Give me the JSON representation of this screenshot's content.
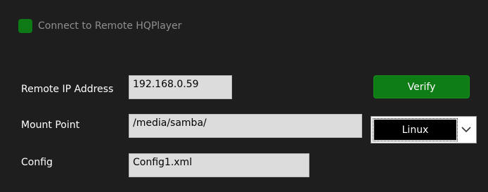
{
  "connect": {
    "label": "Connect to Remote HQPlayer",
    "checked": true
  },
  "form": {
    "remote_ip_label": "Remote IP Address",
    "remote_ip_value": "192.168.0.59",
    "mount_point_label": "Mount Point",
    "mount_point_value": "/media/samba/",
    "config_label": "Config",
    "config_value": "Config1.xml"
  },
  "verify": {
    "label": "Verify"
  },
  "os_select": {
    "selected": "Linux"
  },
  "colors": {
    "background": "#1e1e1e",
    "accent_green": "#0e7d15",
    "field_bg": "#dcdcdc",
    "muted_text": "#8f8f8f"
  },
  "icons": {
    "dropdown": "chevron-down-icon"
  }
}
